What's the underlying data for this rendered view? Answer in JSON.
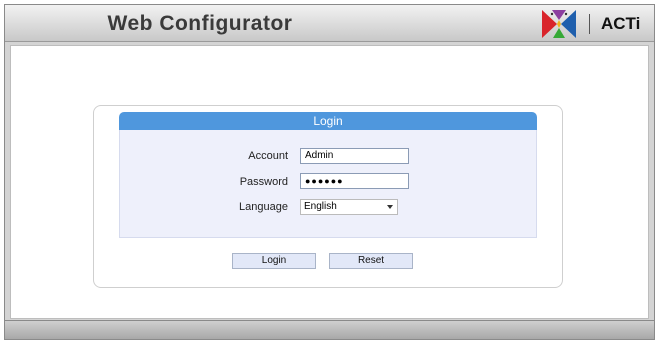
{
  "header": {
    "title": "Web Configurator",
    "brand": "ACTi",
    "logo_icon": "acti-butterfly-logo"
  },
  "login": {
    "title": "Login",
    "account_label": "Account",
    "account_value": "Admin",
    "password_label": "Password",
    "password_mask": "●●●●●●",
    "language_label": "Language",
    "language_value": "English",
    "login_button": "Login",
    "reset_button": "Reset"
  },
  "colors": {
    "header_bar": "#4f97dd",
    "panel_bg": "#eef0fb",
    "button_bg": "#e2e8f8"
  }
}
